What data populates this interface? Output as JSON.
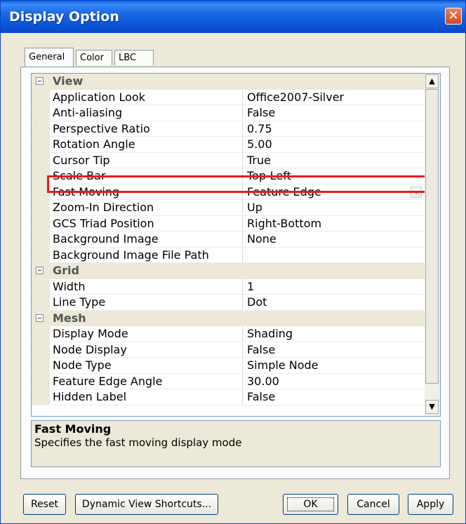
{
  "window": {
    "title": "Display Option",
    "close_symbol": "✕"
  },
  "tabs": [
    {
      "label": "General",
      "active": true
    },
    {
      "label": "Color",
      "active": false
    },
    {
      "label": "LBC",
      "active": false
    }
  ],
  "grid": {
    "rows": [
      {
        "type": "category",
        "name": "View"
      },
      {
        "type": "property",
        "name": "Application Look",
        "value": "Office2007-Silver"
      },
      {
        "type": "property",
        "name": "Anti-aliasing",
        "value": "False"
      },
      {
        "type": "property",
        "name": "Perspective Ratio",
        "value": "0.75"
      },
      {
        "type": "property",
        "name": "Rotation Angle",
        "value": "5.00"
      },
      {
        "type": "property",
        "name": "Cursor Tip",
        "value": "True"
      },
      {
        "type": "property",
        "name": "Scale Bar",
        "value": "Top-Left"
      },
      {
        "type": "property",
        "name": "Fast Moving",
        "value": "Feature Edge",
        "selected": true
      },
      {
        "type": "property",
        "name": "Zoom-In Direction",
        "value": "Up"
      },
      {
        "type": "property",
        "name": "GCS Triad Position",
        "value": "Right-Bottom"
      },
      {
        "type": "property",
        "name": "Background Image",
        "value": "None"
      },
      {
        "type": "property",
        "name": "Background Image File Path",
        "value": ""
      },
      {
        "type": "category",
        "name": "Grid"
      },
      {
        "type": "property",
        "name": "Width",
        "value": "1"
      },
      {
        "type": "property",
        "name": "Line Type",
        "value": "Dot"
      },
      {
        "type": "category",
        "name": "Mesh"
      },
      {
        "type": "property",
        "name": "Display Mode",
        "value": "Shading"
      },
      {
        "type": "property",
        "name": "Node Display",
        "value": "False"
      },
      {
        "type": "property",
        "name": "Node Type",
        "value": "Simple Node"
      },
      {
        "type": "property",
        "name": "Feature Edge Angle",
        "value": "30.00"
      },
      {
        "type": "property",
        "name": "Hidden Label",
        "value": "False"
      }
    ]
  },
  "scrollbar": {
    "up_symbol": "▲",
    "down_symbol": "▼"
  },
  "description": {
    "title": "Fast Moving",
    "text": "Specifies the fast moving display mode"
  },
  "buttons": {
    "reset": "Reset",
    "shortcuts": "Dynamic View Shortcuts...",
    "ok": "OK",
    "cancel": "Cancel",
    "apply": "Apply"
  },
  "colors": {
    "title_bar": "#0a5fe0",
    "highlight": "#e81c1c",
    "dialog_bg": "#ece9d8"
  }
}
